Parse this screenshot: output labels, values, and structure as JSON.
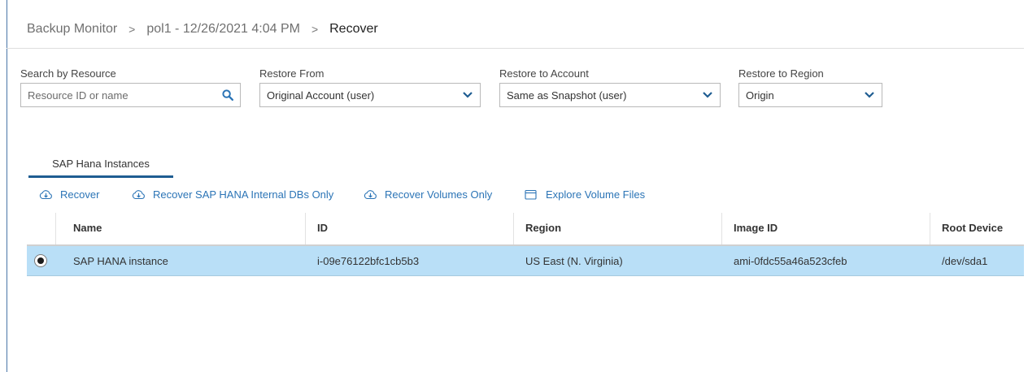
{
  "breadcrumb": {
    "root": "Backup Monitor",
    "policy": "pol1 - 12/26/2021 4:04 PM",
    "current": "Recover",
    "separator": ">"
  },
  "filters": {
    "search": {
      "label": "Search by Resource",
      "placeholder": "Resource ID or name"
    },
    "restore_from": {
      "label": "Restore From",
      "value": "Original Account (user)"
    },
    "restore_to_account": {
      "label": "Restore to Account",
      "value": "Same as Snapshot (user)"
    },
    "restore_to_region": {
      "label": "Restore to Region",
      "value": "Origin"
    }
  },
  "tabs": [
    {
      "label": "SAP Hana Instances",
      "active": true
    }
  ],
  "toolbar": {
    "recover": "Recover",
    "recover_internal_dbs": "Recover SAP HANA Internal DBs Only",
    "recover_volumes": "Recover Volumes Only",
    "explore_files": "Explore Volume Files"
  },
  "table": {
    "columns": [
      "Name",
      "ID",
      "Region",
      "Image ID",
      "Root Device"
    ],
    "rows": [
      {
        "selected": true,
        "name": "SAP HANA instance",
        "id": "i-09e76122bfc1cb5b3",
        "region": "US East (N. Virginia)",
        "image_id": "ami-0fdc55a46a523cfeb",
        "root_device": "/dev/sda1"
      }
    ]
  },
  "icons": {
    "search": "search-icon",
    "dropdown": "chevron-down-icon",
    "recover": "cloud-download-icon",
    "explore": "window-icon",
    "radio": "radio-selected-icon"
  },
  "colors": {
    "accent": "#2b74b6",
    "selected_row": "#b9dff7",
    "tab_underline": "#1f5d92"
  }
}
